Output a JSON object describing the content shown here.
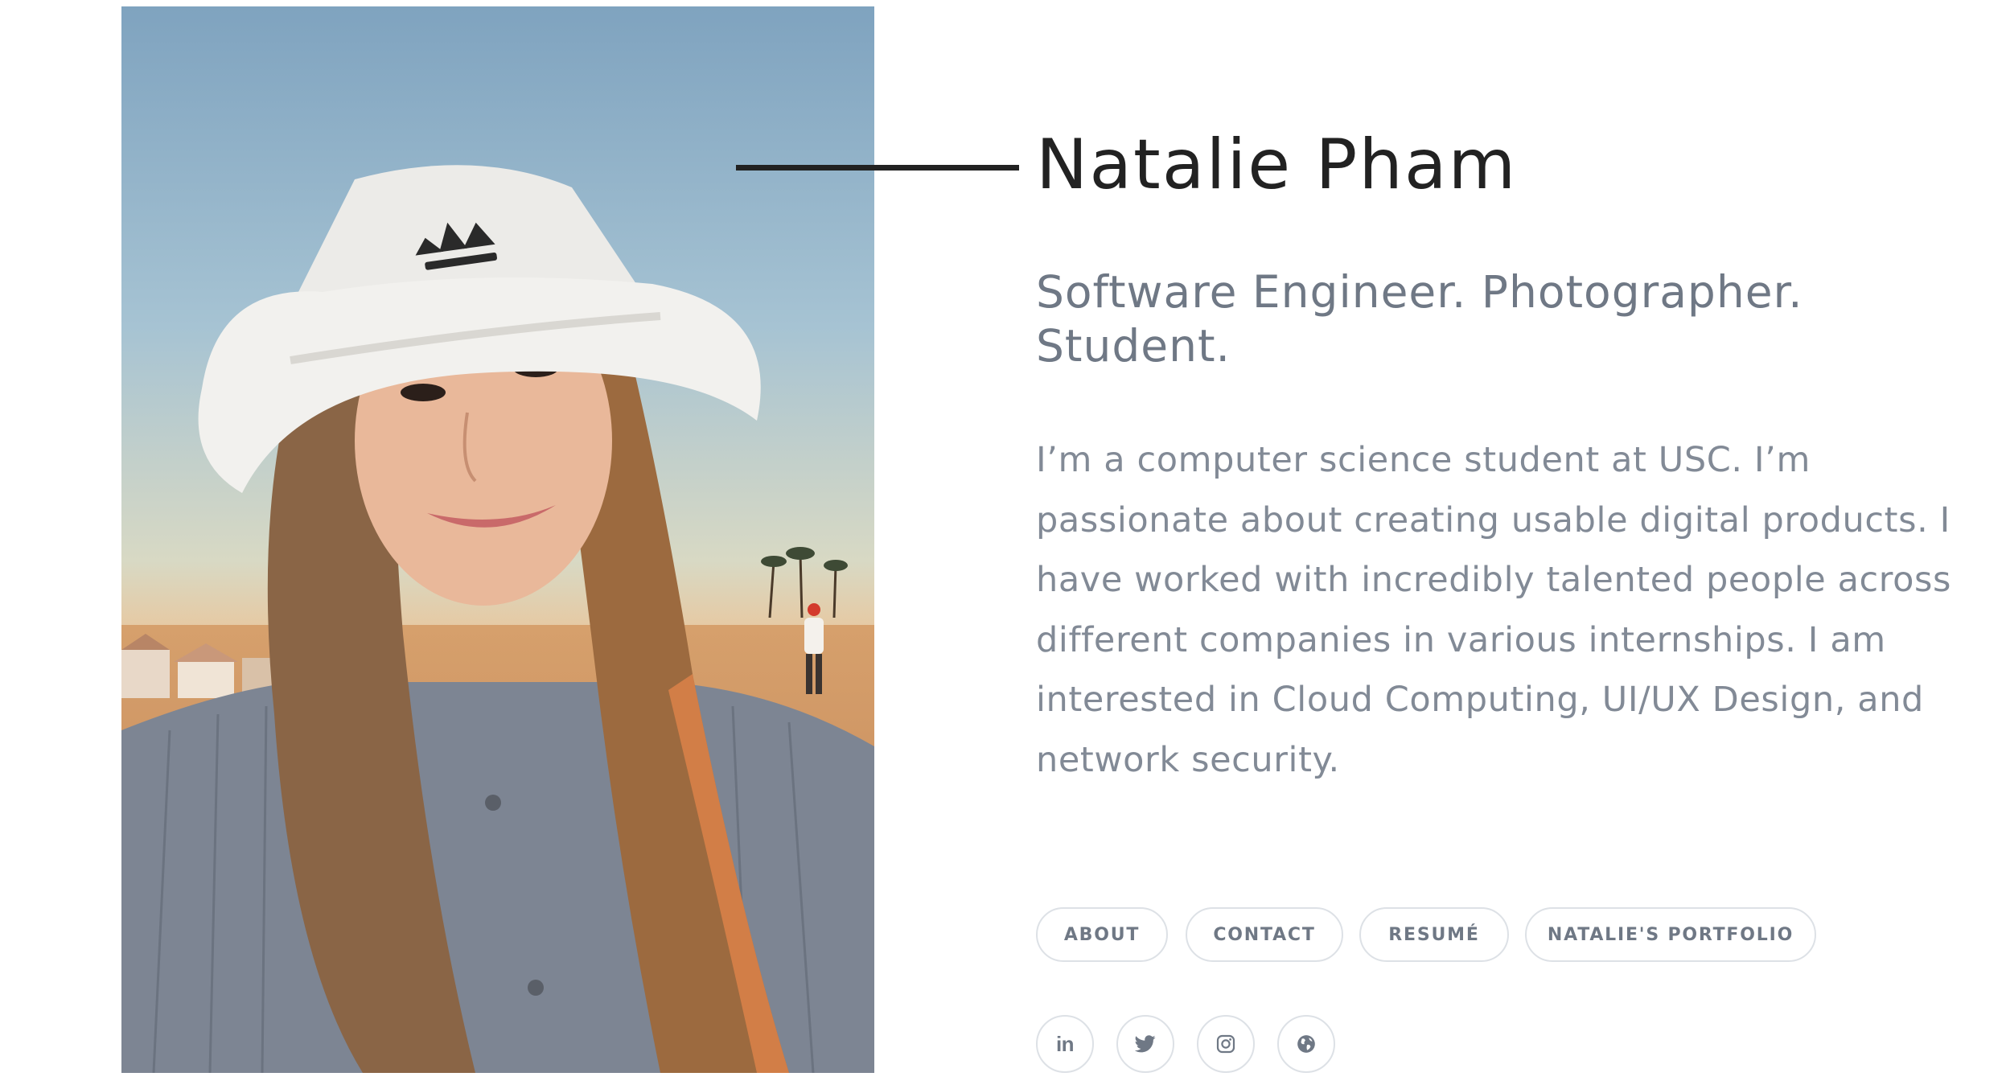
{
  "profile": {
    "name": "Natalie Pham",
    "tagline": "Software Engineer. Photographer. Student.",
    "bio": "I’m a computer science student at USC. I’m passionate about creating usable digital products. I have worked with incredibly talented people across different companies in various internships. I am interested in Cloud Computing, UI/UX Design, and network security.",
    "photo_alt": "Portrait photo"
  },
  "nav": {
    "items": [
      {
        "label": "ABOUT"
      },
      {
        "label": "CONTACT"
      },
      {
        "label": "RESUMÉ"
      },
      {
        "label": "NATALIE'S PORTFOLIO"
      }
    ]
  },
  "social": {
    "linkedin_glyph": "in",
    "icons": [
      "linkedin-icon",
      "twitter-icon",
      "instagram-icon",
      "globe-icon"
    ]
  },
  "colors": {
    "heading": "#222222",
    "text_muted": "#6f7885",
    "body_text": "#828a96",
    "border": "#dde1e6",
    "background": "#ffffff"
  }
}
